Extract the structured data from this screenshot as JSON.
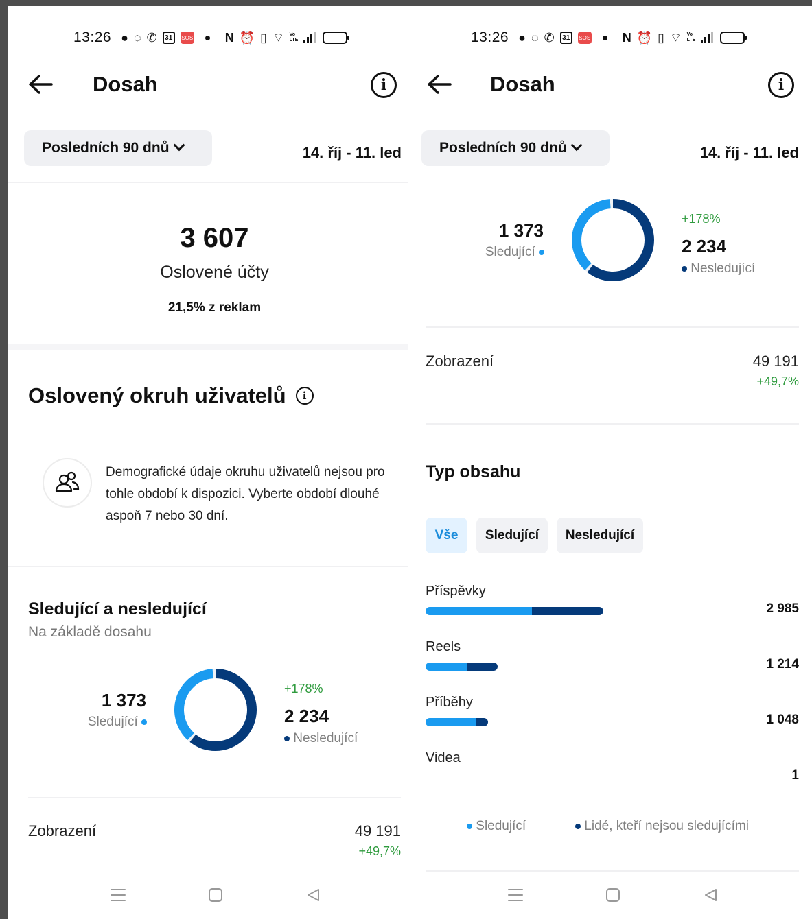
{
  "colors": {
    "followers": "#1a9bf0",
    "non_followers": "#053a7a",
    "positive_change": "#2f9b3e",
    "active_chip_bg": "#e3f2ff"
  },
  "status_bar": {
    "time": "13:26",
    "icons": [
      "chat-bubble-icon",
      "whatsapp-icon",
      "missed-call-icon",
      "calendar-31-icon",
      "sos-icon",
      "nfc-icon",
      "alarm-icon",
      "vibrate-icon",
      "wifi-icon",
      "volte-icon",
      "signal-icon",
      "battery-icon"
    ],
    "calendar_day": "31",
    "sos": "SOS",
    "volte": "Vo LTE",
    "battery_level": 0.4
  },
  "header": {
    "title": "Dosah",
    "back_icon": "arrow-left-icon",
    "info_icon": "info-icon"
  },
  "period": {
    "label": "Posledních 90 dnů",
    "date_range": "14. říj - 11. led"
  },
  "reach": {
    "value": "3 607",
    "label": "Oslovené účty",
    "ads_share": "21,5% z reklam"
  },
  "audience": {
    "title": "Oslovený okruh uživatelů",
    "message_lines": [
      "Demografické údaje okruhu uživatelů nejsou pro",
      "tohle období k dispozici. Vyberte období dlouhé",
      "aspoň 7 nebo 30 dní."
    ]
  },
  "followers_section": {
    "title": "Sledující a nesledující",
    "subtitle": "Na základě dosahu",
    "followers_value": "1 373",
    "followers_label": "Sledující",
    "non_followers_change": "+178%",
    "non_followers_value": "2 234",
    "non_followers_label": "Nesledující",
    "followers_share": 0.381
  },
  "impressions": {
    "label": "Zobrazení",
    "value": "49 191",
    "change": "+49,7%"
  },
  "content_type": {
    "title": "Typ obsahu",
    "chips": [
      {
        "label": "Vše",
        "active": true
      },
      {
        "label": "Sledující",
        "active": false
      },
      {
        "label": "Nesledující",
        "active": false
      }
    ],
    "rows": [
      {
        "label": "Příspěvky",
        "value": "2 985",
        "total": 2985,
        "followers_fraction": 0.6
      },
      {
        "label": "Reels",
        "value": "1 214",
        "total": 1214,
        "followers_fraction": 0.58
      },
      {
        "label": "Příběhy",
        "value": "1 048",
        "total": 1048,
        "followers_fraction": 0.8
      },
      {
        "label": "Videa",
        "value": "1",
        "total": 1,
        "followers_fraction": 0
      }
    ],
    "legend": {
      "followers": "Sledující",
      "non_followers": "Lidé, kteří nejsou sledujícími"
    }
  },
  "nav": {
    "icons": [
      "menu-icon",
      "home-square-icon",
      "back-triangle-icon"
    ]
  }
}
